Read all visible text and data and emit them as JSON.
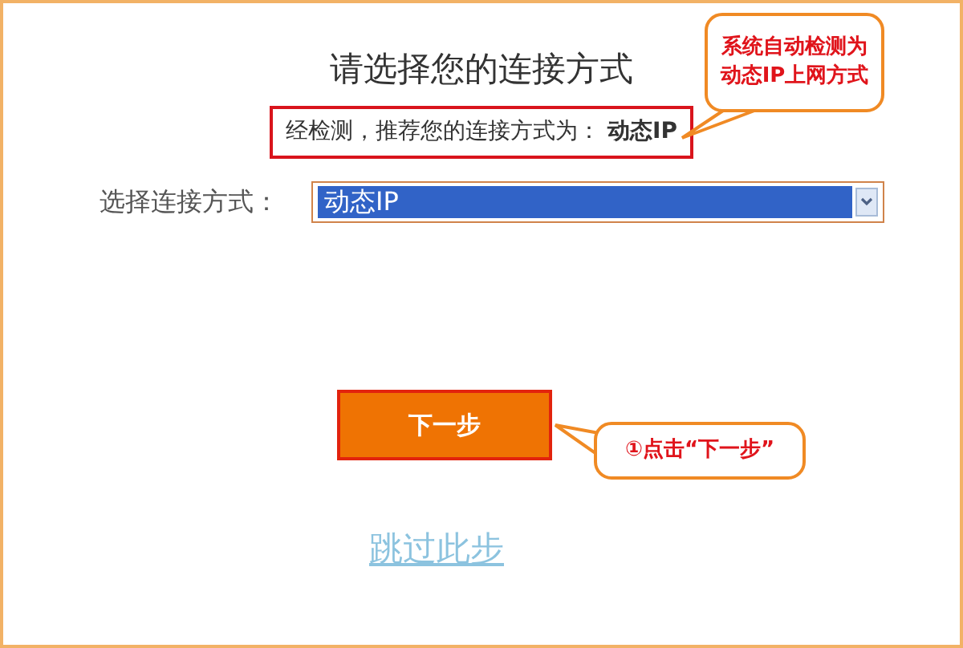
{
  "title": "请选择您的连接方式",
  "detection": {
    "text": "经检测，推荐您的连接方式为：",
    "value": "动态IP",
    "highlighted": true
  },
  "connection_field": {
    "label": "选择连接方式：",
    "value": "动态IP",
    "selected": true
  },
  "next_button": {
    "label": "下一步",
    "highlighted": true
  },
  "skip_link": "跳过此步",
  "callouts": [
    {
      "lines": [
        "系统自动检测为",
        "动态IP上网方式"
      ]
    },
    {
      "lines": [
        "①点击“下一步”"
      ]
    }
  ]
}
